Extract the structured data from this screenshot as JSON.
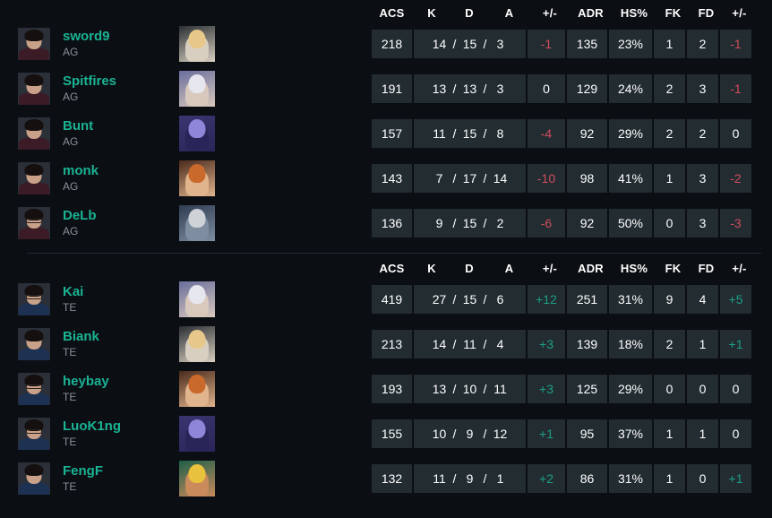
{
  "columns": {
    "acs": "ACS",
    "k": "K",
    "d": "D",
    "a": "A",
    "plusminus": "+/-",
    "adr": "ADR",
    "hs": "HS%",
    "fk": "FK",
    "fd": "FD",
    "fkfd_diff": "+/-"
  },
  "colors": {
    "player_name": "#1ab394",
    "positive": "#1f9e86",
    "negative": "#d14d5e",
    "cell_bg": "#222c31",
    "page_bg": "#0b0e13",
    "team_tag": "#8a9098"
  },
  "teams": [
    {
      "id": "team-ag",
      "tag": "AG",
      "players": [
        {
          "name": "sword9",
          "tag": "AG",
          "agent": "agent-phoenix",
          "agent_colors": [
            "#2b2f34",
            "#e8c88a",
            "#d8cfc0"
          ],
          "acs": "218",
          "k": "14",
          "d": "15",
          "a": "3",
          "kd_diff": "-1",
          "kd_diff_sign": "neg",
          "adr": "135",
          "hs": "23%",
          "fk": "1",
          "fd": "2",
          "fkfd_diff": "-1",
          "fkfd_diff_sign": "neg"
        },
        {
          "name": "Spitfires",
          "tag": "AG",
          "agent": "agent-jett",
          "agent_colors": [
            "#6a6e9c",
            "#e6e6ee",
            "#d9c9bd"
          ],
          "acs": "191",
          "k": "13",
          "d": "13",
          "a": "3",
          "kd_diff": "0",
          "kd_diff_sign": "zero",
          "adr": "129",
          "hs": "24%",
          "fk": "2",
          "fd": "3",
          "fkfd_diff": "-1",
          "fkfd_diff_sign": "neg"
        },
        {
          "name": "Bunt",
          "tag": "AG",
          "agent": "agent-omen",
          "agent_colors": [
            "#3a3570",
            "#8e86d8",
            "#2a2558"
          ],
          "acs": "157",
          "k": "11",
          "d": "15",
          "a": "8",
          "kd_diff": "-4",
          "kd_diff_sign": "neg",
          "adr": "92",
          "hs": "29%",
          "fk": "2",
          "fd": "2",
          "fkfd_diff": "0",
          "fkfd_diff_sign": "zero"
        },
        {
          "name": "monk",
          "tag": "AG",
          "agent": "agent-breach",
          "agent_colors": [
            "#4a2a1c",
            "#c96a2c",
            "#e0b48c"
          ],
          "acs": "143",
          "k": "7",
          "d": "17",
          "a": "14",
          "kd_diff": "-10",
          "kd_diff_sign": "neg",
          "adr": "98",
          "hs": "41%",
          "fk": "1",
          "fd": "3",
          "fkfd_diff": "-2",
          "fkfd_diff_sign": "neg"
        },
        {
          "name": "DeLb",
          "tag": "AG",
          "agent": "agent-sova",
          "agent_colors": [
            "#2f3c52",
            "#cfd3d8",
            "#7e8da0"
          ],
          "acs": "136",
          "k": "9",
          "d": "15",
          "a": "2",
          "kd_diff": "-6",
          "kd_diff_sign": "neg",
          "adr": "92",
          "hs": "50%",
          "fk": "0",
          "fd": "3",
          "fkfd_diff": "-3",
          "fkfd_diff_sign": "neg"
        }
      ]
    },
    {
      "id": "team-te",
      "tag": "TE",
      "players": [
        {
          "name": "Kai",
          "tag": "TE",
          "agent": "agent-jett",
          "agent_colors": [
            "#6a6e9c",
            "#e6e6ee",
            "#d9c9bd"
          ],
          "acs": "419",
          "k": "27",
          "d": "15",
          "a": "6",
          "kd_diff": "+12",
          "kd_diff_sign": "pos",
          "adr": "251",
          "hs": "31%",
          "fk": "9",
          "fd": "4",
          "fkfd_diff": "+5",
          "fkfd_diff_sign": "pos"
        },
        {
          "name": "Biank",
          "tag": "TE",
          "agent": "agent-phoenix",
          "agent_colors": [
            "#2b2f34",
            "#e8c88a",
            "#d8cfc0"
          ],
          "acs": "213",
          "k": "14",
          "d": "11",
          "a": "4",
          "kd_diff": "+3",
          "kd_diff_sign": "pos",
          "adr": "139",
          "hs": "18%",
          "fk": "2",
          "fd": "1",
          "fkfd_diff": "+1",
          "fkfd_diff_sign": "pos"
        },
        {
          "name": "heybay",
          "tag": "TE",
          "agent": "agent-breach",
          "agent_colors": [
            "#4a2a1c",
            "#c96a2c",
            "#e0b48c"
          ],
          "acs": "193",
          "k": "13",
          "d": "10",
          "a": "11",
          "kd_diff": "+3",
          "kd_diff_sign": "pos",
          "adr": "125",
          "hs": "29%",
          "fk": "0",
          "fd": "0",
          "fkfd_diff": "0",
          "fkfd_diff_sign": "zero"
        },
        {
          "name": "LuoK1ng",
          "tag": "TE",
          "agent": "agent-omen",
          "agent_colors": [
            "#3a3570",
            "#8e86d8",
            "#2a2558"
          ],
          "acs": "155",
          "k": "10",
          "d": "9",
          "a": "12",
          "kd_diff": "+1",
          "kd_diff_sign": "pos",
          "adr": "95",
          "hs": "37%",
          "fk": "1",
          "fd": "1",
          "fkfd_diff": "0",
          "fkfd_diff_sign": "zero"
        },
        {
          "name": "FengF",
          "tag": "TE",
          "agent": "agent-raze",
          "agent_colors": [
            "#1f5f4a",
            "#e8c23c",
            "#c98a5c"
          ],
          "acs": "132",
          "k": "11",
          "d": "9",
          "a": "1",
          "kd_diff": "+2",
          "kd_diff_sign": "pos",
          "adr": "86",
          "hs": "31%",
          "fk": "1",
          "fd": "0",
          "fkfd_diff": "+1",
          "fkfd_diff_sign": "pos"
        }
      ]
    }
  ]
}
